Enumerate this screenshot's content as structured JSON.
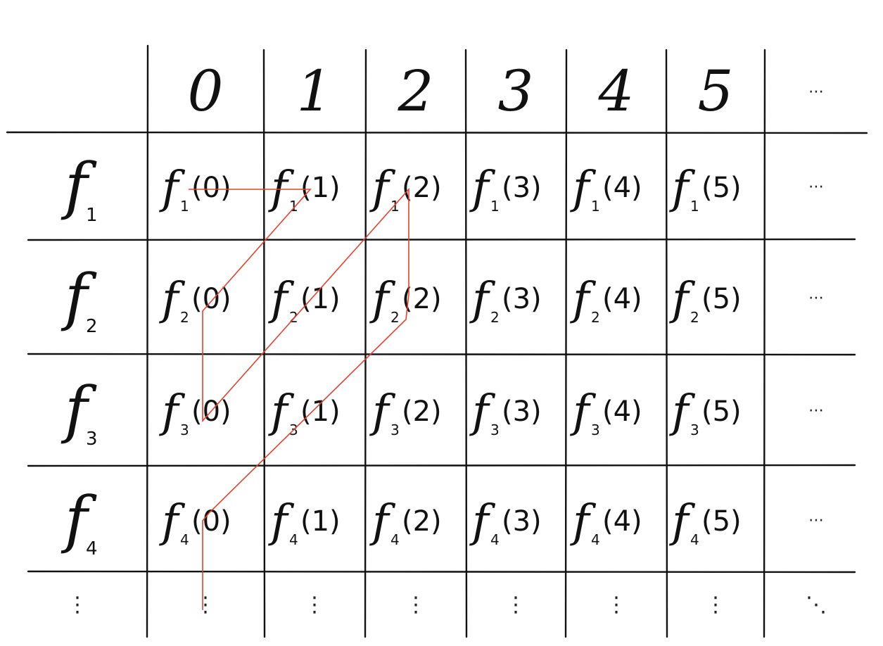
{
  "header": {
    "columns": [
      "0",
      "1",
      "2",
      "3",
      "4",
      "5",
      "..."
    ]
  },
  "rows": [
    {
      "label": "f",
      "sub": "1",
      "cells": [
        {
          "f": "f",
          "sub": "1",
          "arg": "(0)"
        },
        {
          "f": "f",
          "sub": "1",
          "arg": "(1)"
        },
        {
          "f": "f",
          "sub": "1",
          "arg": "(2)"
        },
        {
          "f": "f",
          "sub": "1",
          "arg": "(3)"
        },
        {
          "f": "f",
          "sub": "1",
          "arg": "(4)"
        },
        {
          "f": "f",
          "sub": "1",
          "arg": "(5)"
        }
      ],
      "trail": "..."
    },
    {
      "label": "f",
      "sub": "2",
      "cells": [
        {
          "f": "f",
          "sub": "2",
          "arg": "(0)"
        },
        {
          "f": "f",
          "sub": "2",
          "arg": "(1)"
        },
        {
          "f": "f",
          "sub": "2",
          "arg": "(2)"
        },
        {
          "f": "f",
          "sub": "2",
          "arg": "(3)"
        },
        {
          "f": "f",
          "sub": "2",
          "arg": "(4)"
        },
        {
          "f": "f",
          "sub": "2",
          "arg": "(5)"
        }
      ],
      "trail": "..."
    },
    {
      "label": "f",
      "sub": "3",
      "cells": [
        {
          "f": "f",
          "sub": "3",
          "arg": "(0)"
        },
        {
          "f": "f",
          "sub": "3",
          "arg": "(1)"
        },
        {
          "f": "f",
          "sub": "3",
          "arg": "(2)"
        },
        {
          "f": "f",
          "sub": "3",
          "arg": "(3)"
        },
        {
          "f": "f",
          "sub": "3",
          "arg": "(4)"
        },
        {
          "f": "f",
          "sub": "3",
          "arg": "(5)"
        }
      ],
      "trail": "..."
    },
    {
      "label": "f",
      "sub": "4",
      "cells": [
        {
          "f": "f",
          "sub": "4",
          "arg": "(0)"
        },
        {
          "f": "f",
          "sub": "4",
          "arg": "(1)"
        },
        {
          "f": "f",
          "sub": "4",
          "arg": "(2)"
        },
        {
          "f": "f",
          "sub": "4",
          "arg": "(3)"
        },
        {
          "f": "f",
          "sub": "4",
          "arg": "(4)"
        },
        {
          "f": "f",
          "sub": "4",
          "arg": "(5)"
        }
      ],
      "trail": "..."
    }
  ],
  "bottom_row": {
    "cells": [
      "⋮",
      "⋮",
      "⋮",
      "⋮",
      "⋮",
      "⋮",
      "⋮",
      "⋱"
    ]
  },
  "colors": {
    "ink": "#111111",
    "path": "#e0432f"
  },
  "enumeration_path": {
    "order": [
      "f1(0)",
      "f1(1)",
      "f2(0)",
      "f3(0)",
      "f1(2)",
      "f2(2)",
      "f4(0)",
      "⋮"
    ]
  }
}
